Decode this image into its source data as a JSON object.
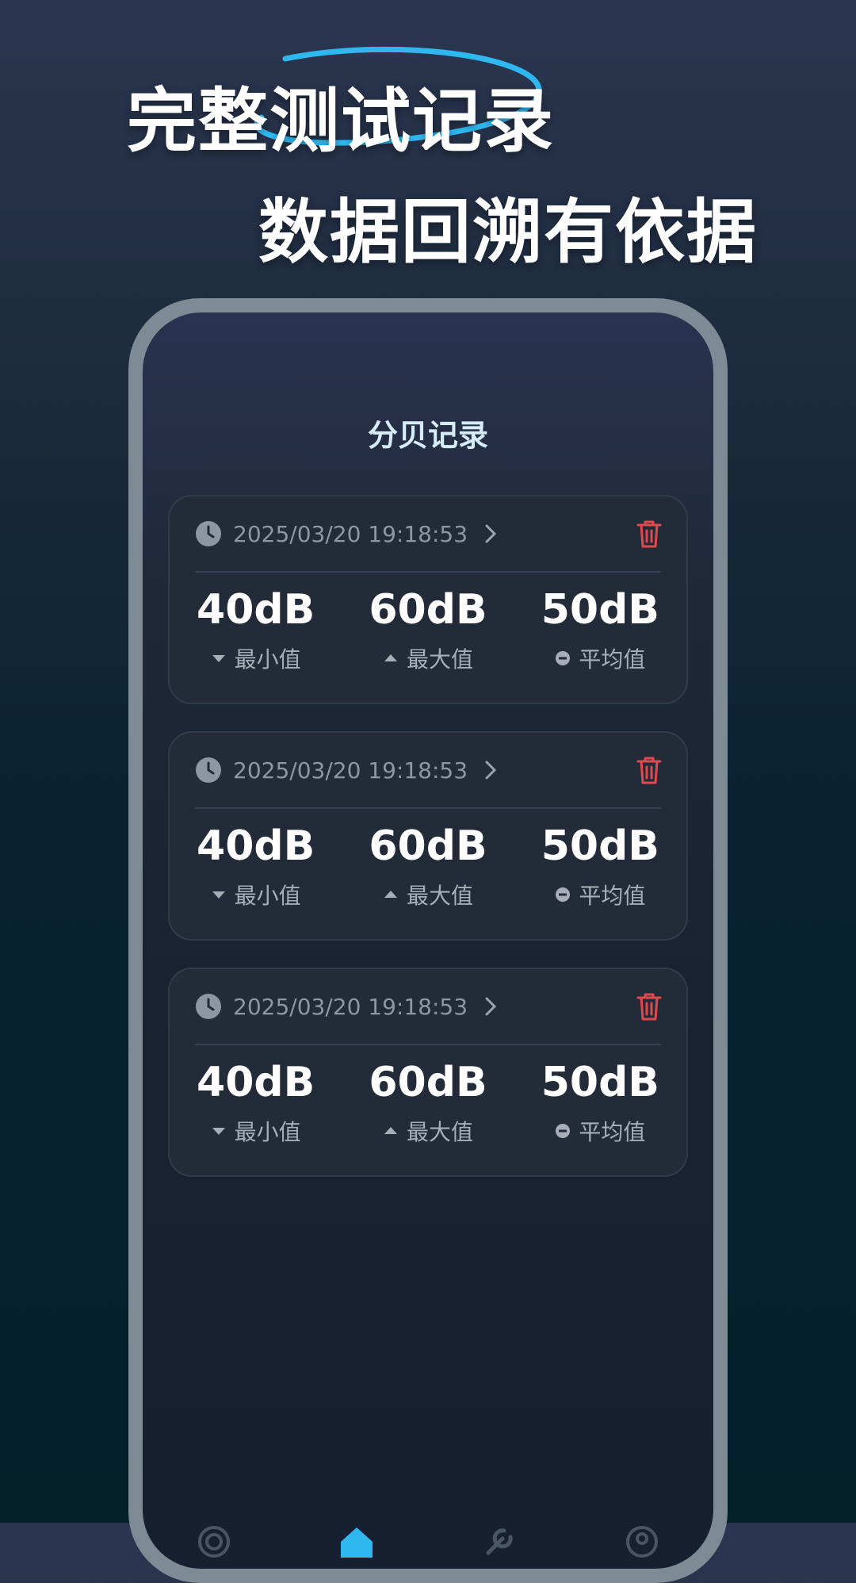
{
  "headline": {
    "line1": "完整测试记录",
    "line2": "数据回溯有依据"
  },
  "screen": {
    "title": "分贝记录"
  },
  "records": [
    {
      "datetime": "2025/03/20 19:18:53",
      "min": "40dB",
      "max": "60dB",
      "avg": "50dB"
    },
    {
      "datetime": "2025/03/20 19:18:53",
      "min": "40dB",
      "max": "60dB",
      "avg": "50dB"
    },
    {
      "datetime": "2025/03/20 19:18:53",
      "min": "40dB",
      "max": "60dB",
      "avg": "50dB"
    }
  ],
  "labels": {
    "min": "最小值",
    "max": "最大值",
    "avg": "平均值"
  },
  "icons": {
    "clock": "clock-icon",
    "chevron": "chevron-right-icon",
    "trash": "trash-icon",
    "min": "caret-down-icon",
    "max": "caret-up-icon",
    "avg": "minus-circle-icon"
  },
  "tabbar": [
    "decibel-tab",
    "home-tab",
    "tools-tab",
    "profile-tab"
  ],
  "colors": {
    "accent": "#2fb8f0",
    "delete": "#e04a4f",
    "card": "#222b37"
  }
}
